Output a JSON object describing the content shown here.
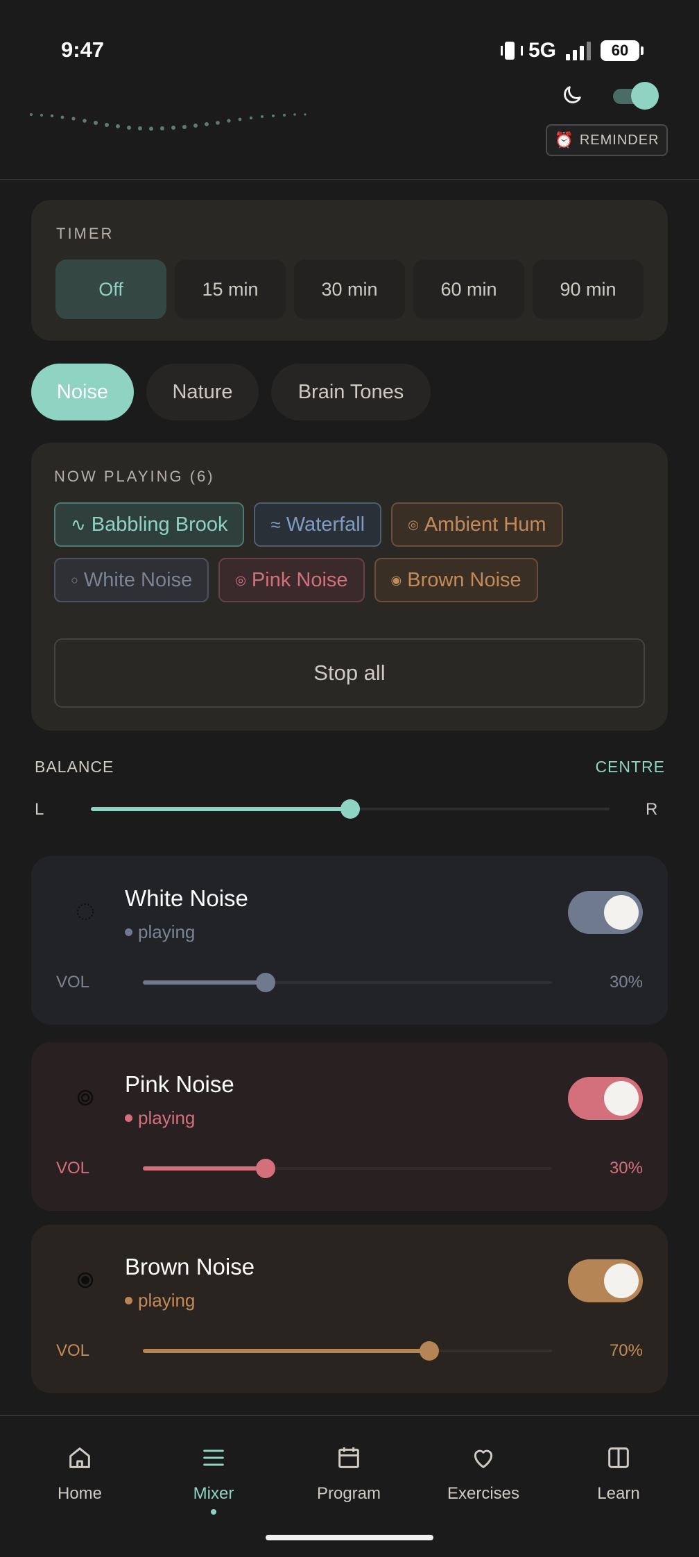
{
  "status_bar": {
    "time": "9:47",
    "network": "5G",
    "battery": "60"
  },
  "header": {
    "reminder_label": "REMINDER",
    "dark_mode_on": true
  },
  "timer": {
    "label": "TIMER",
    "options": [
      "Off",
      "15 min",
      "30 min",
      "60 min",
      "90 min"
    ],
    "selected": "Off"
  },
  "categories": {
    "tabs": [
      "Noise",
      "Nature",
      "Brain Tones"
    ],
    "selected": "Noise"
  },
  "now_playing": {
    "label": "NOW PLAYING (6)",
    "chips": [
      {
        "glyph": "∿",
        "label": "Babbling Brook"
      },
      {
        "glyph": "≈",
        "label": "Waterfall"
      },
      {
        "glyph": "◎",
        "label": "Ambient Hum"
      },
      {
        "glyph": "○",
        "label": "White Noise"
      },
      {
        "glyph": "◎",
        "label": "Pink Noise"
      },
      {
        "glyph": "◉",
        "label": "Brown Noise"
      }
    ],
    "stop_all_label": "Stop all"
  },
  "balance": {
    "label": "BALANCE",
    "value": "CENTRE",
    "left": "L",
    "right": "R",
    "position": 0.5
  },
  "sounds": [
    {
      "name": "White Noise",
      "state": "playing",
      "vol_label": "VOL",
      "volume": "30%",
      "level": 0.3,
      "on": true,
      "color": "#6f7a8e"
    },
    {
      "name": "Pink Noise",
      "state": "playing",
      "vol_label": "VOL",
      "volume": "30%",
      "level": 0.3,
      "on": true,
      "color": "#d4707c"
    },
    {
      "name": "Brown Noise",
      "state": "playing",
      "vol_label": "VOL",
      "volume": "70%",
      "level": 0.7,
      "on": true,
      "color": "#b58555"
    }
  ],
  "nav": {
    "items": [
      {
        "label": "Home",
        "icon": "home-icon"
      },
      {
        "label": "Mixer",
        "icon": "menu-icon"
      },
      {
        "label": "Program",
        "icon": "calendar-icon"
      },
      {
        "label": "Exercises",
        "icon": "heart-icon"
      },
      {
        "label": "Learn",
        "icon": "book-icon"
      }
    ],
    "active": "Mixer"
  },
  "colors": {
    "accent": "#8fd3c2",
    "background": "#1b1b1b",
    "card": "#2a2825"
  }
}
